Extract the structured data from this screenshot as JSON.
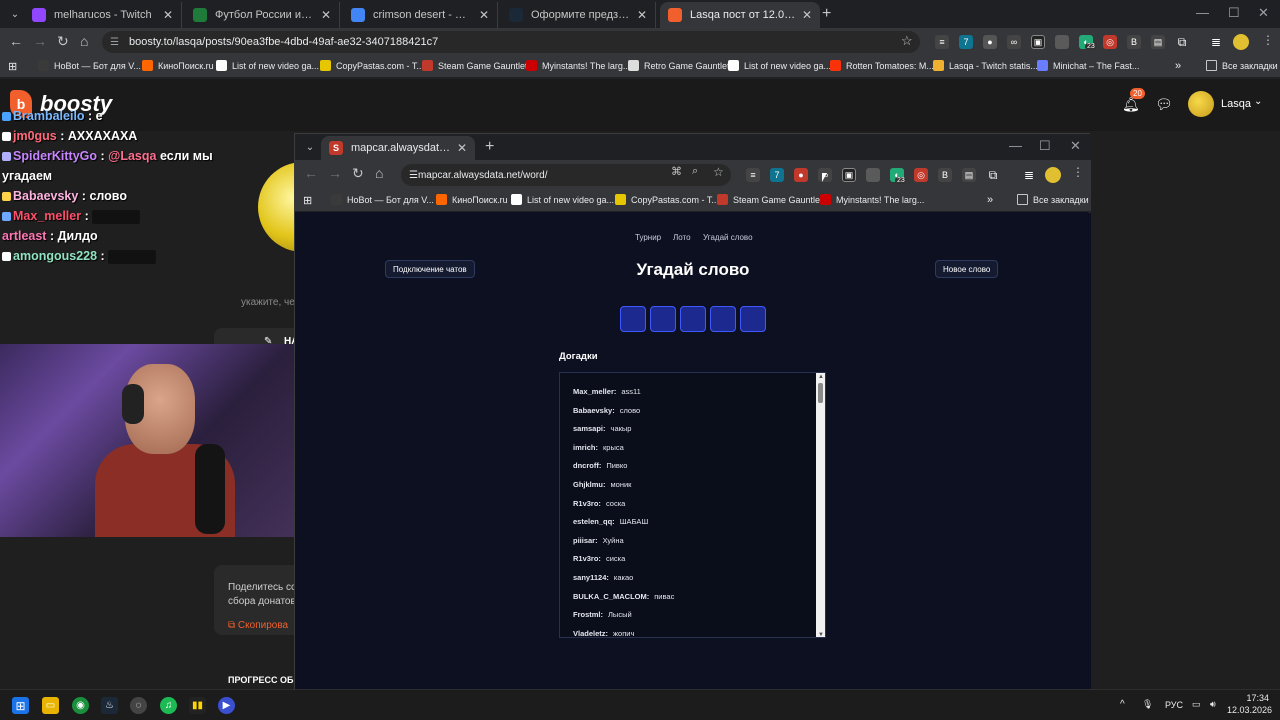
{
  "browser": {
    "tabs": [
      {
        "title": "melharucos - Twitch",
        "color": "#9146ff",
        "icon": "twitch-icon"
      },
      {
        "title": "Футбол России и мира 2026 -",
        "color": "#1e7b3a",
        "icon": "sport-icon"
      },
      {
        "title": "crimson desert - Поиск в Goog",
        "color": "#4285f4",
        "icon": "google-icon"
      },
      {
        "title": "Оформите предзаказ на Crims",
        "color": "#1b2838",
        "icon": "steam-icon"
      },
      {
        "title": "Lasqa пост от 12.03.2026 на Bo",
        "color": "#f15f2c",
        "icon": "boosty-icon"
      }
    ],
    "url": "boosty.to/lasqa/posts/90ea3fbe-4dbd-49af-ae32-3407188421c7",
    "bookmarks": [
      {
        "label": "HoBot — Бот для V...",
        "color": "#3a3a3a"
      },
      {
        "label": "КиноПоиск.ru",
        "color": "#ff6600"
      },
      {
        "label": "List of new video ga...",
        "color": "#ffffff"
      },
      {
        "label": "CopyPastas.com - T...",
        "color": "#e6c600"
      },
      {
        "label": "Steam Game Gauntlet",
        "color": "#c0392b"
      },
      {
        "label": "Myinstants! The larg...",
        "color": "#cc0000"
      },
      {
        "label": "Retro Game Gauntlet",
        "color": "#dddddd"
      },
      {
        "label": "List of new video ga...",
        "color": "#ffffff"
      },
      {
        "label": "Rotten Tomatoes: M...",
        "color": "#fa320a"
      },
      {
        "label": "Lasqa - Twitch statis...",
        "color": "#f0b030"
      },
      {
        "label": "Minichat – The Fast...",
        "color": "#6a7cff"
      }
    ],
    "all_bookmarks": "Все закладки",
    "ext_badge": "23"
  },
  "boosty": {
    "logo": "boosty",
    "notif_count": "20",
    "username": "Lasqa",
    "snippet_hint": "укажите, че",
    "card_btn": "НА",
    "share_line1": "Поделитесь сс",
    "share_line2": "сбора донатов",
    "copy_label": "Скопирова",
    "progress_title": "ПРОГРЕСС ОБ"
  },
  "chat": [
    {
      "name": "Brambaleilo",
      "cls": "nm1",
      "msg": "е",
      "badge": "#4aa3ff"
    },
    {
      "name": "jm0gus",
      "cls": "nm2",
      "msg": "АХХАХАХА",
      "badge": "#ffffff"
    },
    {
      "name": "SpiderKittyGo",
      "cls": "nm3",
      "mention": "@Lasqa",
      "msg": "если мы",
      "badge": "#b0b0ff"
    },
    {
      "name": "",
      "cls": "",
      "msg": "угадаем",
      "badge": ""
    },
    {
      "name": "Babaevsky",
      "cls": "nm4",
      "msg": "слово",
      "badge": "#ffd24a"
    },
    {
      "name": "Max_meller",
      "cls": "nm5",
      "msg": "",
      "emote": true,
      "badge": "#6fa8ff"
    },
    {
      "name": "artleast",
      "cls": "nm6",
      "msg": "Дилдо",
      "badge": ""
    },
    {
      "name": "amongous228",
      "cls": "nm7",
      "msg": "",
      "emote": true,
      "badge": "#ffffff"
    }
  ],
  "popup": {
    "tab_title": "mapcar.alwaysdata.net/word/",
    "url": "mapcar.alwaysdata.net/word/",
    "bookmarks": [
      {
        "label": "HoBot — Бот для V...",
        "color": "#3a3a3a"
      },
      {
        "label": "КиноПоиск.ru",
        "color": "#ff6600"
      },
      {
        "label": "List of new video ga...",
        "color": "#ffffff"
      },
      {
        "label": "CopyPastas.com - T...",
        "color": "#e6c600"
      },
      {
        "label": "Steam Game Gauntlet",
        "color": "#c0392b"
      },
      {
        "label": "Myinstants! The larg...",
        "color": "#cc0000"
      }
    ],
    "all_bookmarks": "Все закладки",
    "ext_badge": "23",
    "nav": [
      "Турнир",
      "Лото",
      "Угадай слово"
    ],
    "connect_btn": "Подключение чатов",
    "title": "Угадай слово",
    "new_word_btn": "Новое слово",
    "guesses_label": "Догадки",
    "guesses": [
      {
        "user": "Max_meller:",
        "word": "ass11"
      },
      {
        "user": "Babaevsky:",
        "word": "слово"
      },
      {
        "user": "samsapi:",
        "word": "чакыр"
      },
      {
        "user": "imrich:",
        "word": "крыса"
      },
      {
        "user": "dncroff:",
        "word": "Пивко"
      },
      {
        "user": "Ghjklmu:",
        "word": "моник"
      },
      {
        "user": "R1v3ro:",
        "word": "соска"
      },
      {
        "user": "estelen_qq:",
        "word": "ШАБАШ"
      },
      {
        "user": "piiisar:",
        "word": "Хуйна"
      },
      {
        "user": "R1v3ro:",
        "word": "сиска"
      },
      {
        "user": "sany1124:",
        "word": "какао"
      },
      {
        "user": "BULKA_C_MACLOM:",
        "word": "пивас"
      },
      {
        "user": "Frostml:",
        "word": "Лысый"
      },
      {
        "user": "Vladeletz:",
        "word": "жопич"
      }
    ]
  },
  "taskbar": {
    "lang": "РУС",
    "time": "17:34",
    "date": "12.03.2026"
  }
}
